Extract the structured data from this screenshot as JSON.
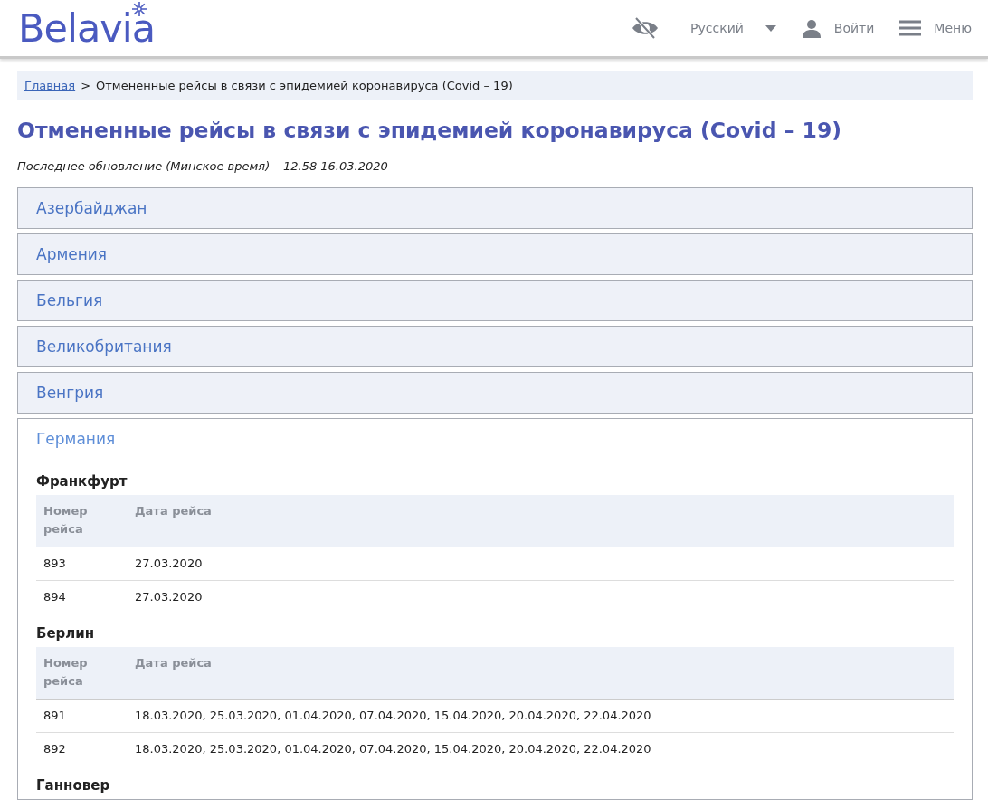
{
  "header": {
    "logo": "Belavia",
    "language": "Русский",
    "login": "Войти",
    "menu": "Меню"
  },
  "breadcrumb": {
    "home": "Главная",
    "separator": ">",
    "current": "Отмененные рейсы в связи с эпидемией коронавируса (Covid – 19)"
  },
  "title": "Отмененные рейсы в связи с эпидемией коронавируса (Covid – 19)",
  "updated": "Последнее обновление (Минское время) – 12.58 16.03.2020",
  "countries": [
    {
      "name": "Азербайджан",
      "expanded": false
    },
    {
      "name": "Армения",
      "expanded": false
    },
    {
      "name": "Бельгия",
      "expanded": false
    },
    {
      "name": "Великобритания",
      "expanded": false
    },
    {
      "name": "Венгрия",
      "expanded": false
    },
    {
      "name": "Германия",
      "expanded": true,
      "cities": [
        {
          "name": "Франкфурт",
          "columns": [
            "Номер рейса",
            "Дата рейса"
          ],
          "rows": [
            [
              "893",
              "27.03.2020"
            ],
            [
              "894",
              "27.03.2020"
            ]
          ]
        },
        {
          "name": "Берлин",
          "columns": [
            "Номер рейса",
            "Дата рейса"
          ],
          "rows": [
            [
              "891",
              "18.03.2020, 25.03.2020, 01.04.2020, 07.04.2020, 15.04.2020, 20.04.2020, 22.04.2020"
            ],
            [
              "892",
              "18.03.2020, 25.03.2020, 01.04.2020, 07.04.2020, 15.04.2020, 20.04.2020, 22.04.2020"
            ]
          ]
        },
        {
          "name": "Ганновер"
        }
      ]
    }
  ]
}
